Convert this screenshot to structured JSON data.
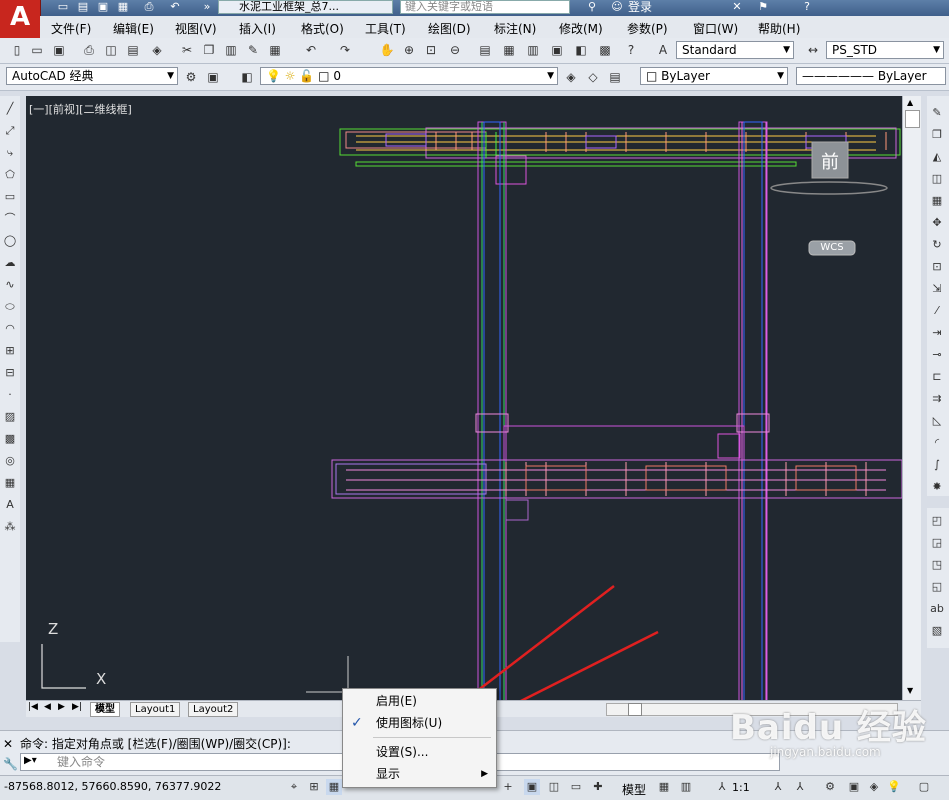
{
  "title_bar": {
    "app_logo": "A",
    "document_title": "水泥工业框架_总7...",
    "search_placeholder": "键入关键字或短语",
    "login_label": "登录"
  },
  "menus": [
    "文件(F)",
    "编辑(E)",
    "视图(V)",
    "插入(I)",
    "格式(O)",
    "工具(T)",
    "绘图(D)",
    "标注(N)",
    "修改(M)",
    "参数(P)",
    "窗口(W)",
    "帮助(H)"
  ],
  "toolbar": {
    "text_style": "Standard",
    "dim_style": "PS_STD",
    "workspace": "AutoCAD 经典",
    "layer": "0",
    "color": "ByLayer",
    "linetype": "ByLayer"
  },
  "viewport": {
    "label": "[一][前视][二维线框]",
    "viewcube_face": "前",
    "wcs_label": "WCS",
    "ucs_z": "Z",
    "ucs_x": "X"
  },
  "layout_tabs": [
    "模型",
    "Layout1",
    "Layout2"
  ],
  "command": {
    "history": "命令: 指定对角点或 [栏选(F)/圈围(WP)/圈交(CP)]:",
    "placeholder": "键入命令"
  },
  "status": {
    "coordinates": "-87568.8012, 57660.8590, 76377.9022",
    "model_label": "模型",
    "scale_label": "1:1"
  },
  "context_menu": {
    "items": [
      {
        "label": "启用(E)",
        "checked": false
      },
      {
        "label": "使用图标(U)",
        "checked": true
      },
      {
        "label": "设置(S)...",
        "checked": false
      },
      {
        "label": "显示",
        "submenu": true
      }
    ]
  },
  "watermark": {
    "brand": "Baidu 经验",
    "url": "jingyan.baidu.com"
  },
  "colors": {
    "canvas_bg": "#212830",
    "arrow": "#e02020",
    "brand_red": "#c8261e"
  }
}
